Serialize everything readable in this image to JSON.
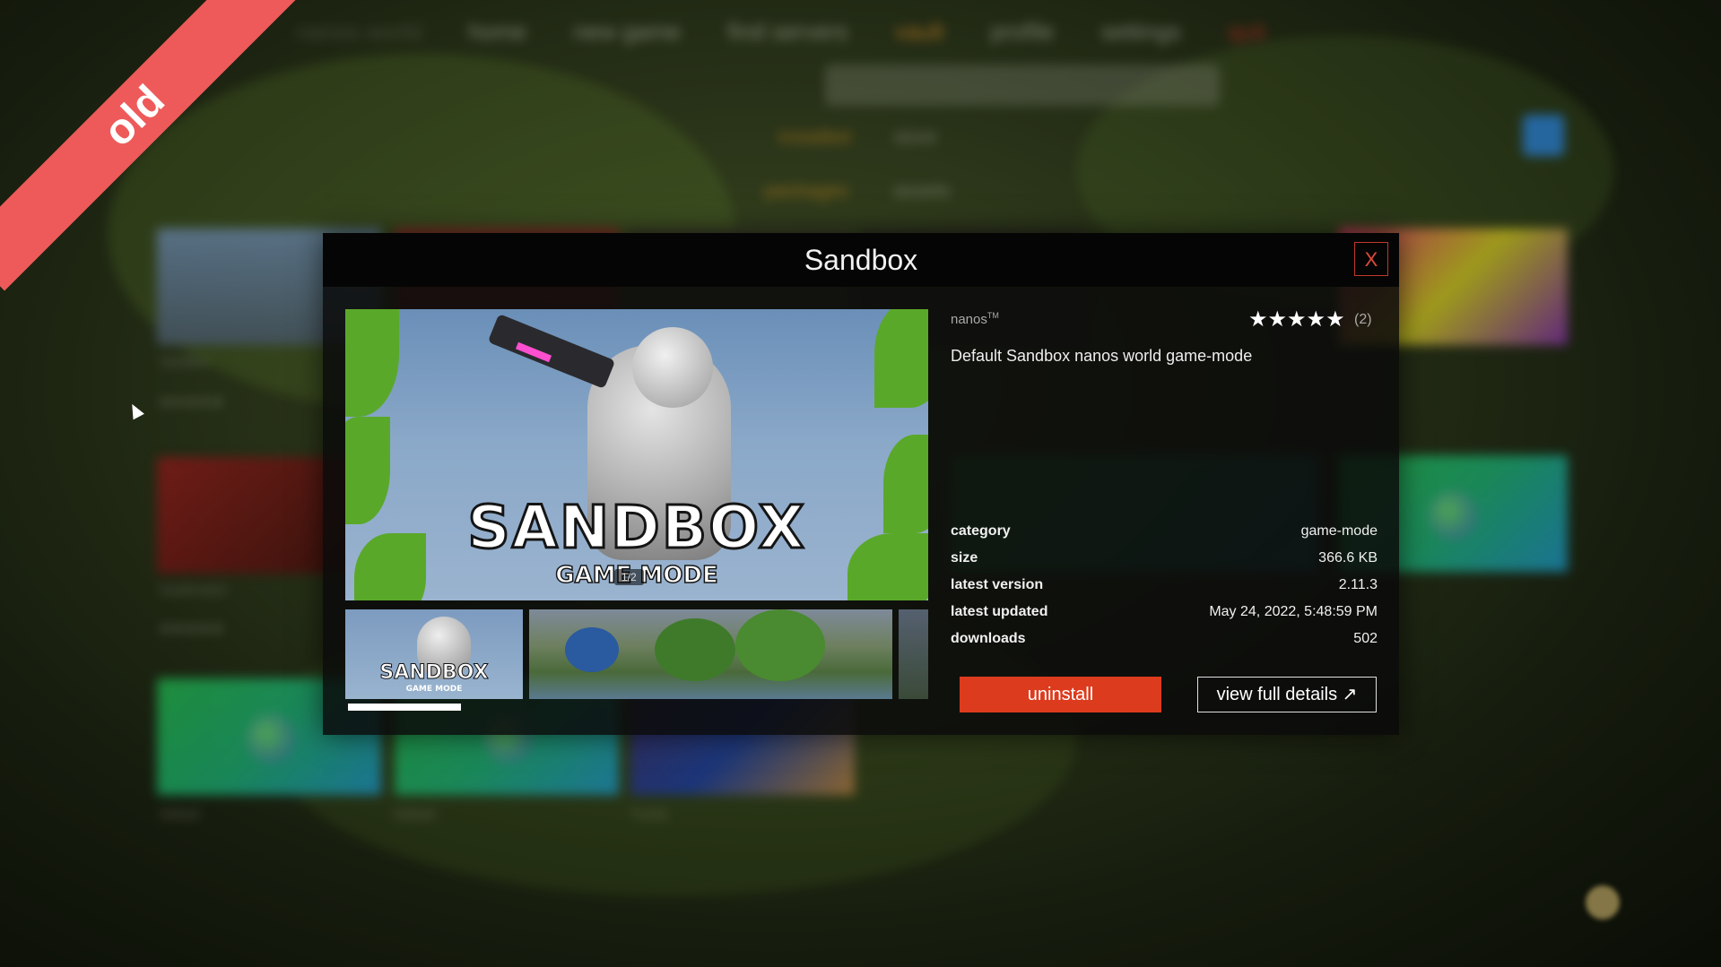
{
  "ribbon": {
    "label": "old"
  },
  "background": {
    "nav": [
      "home",
      "new game",
      "find servers",
      "vault",
      "profile",
      "settings"
    ],
    "active_nav": "vault",
    "accent_color": "#f0962a"
  },
  "modal": {
    "title": "Sandbox",
    "close_label": "X",
    "author": "nanos",
    "author_mark": "TM",
    "stars": "★★★★★",
    "rating_count": "(2)",
    "description": "Default Sandbox nanos world game-mode",
    "image": {
      "logo": "SANDBOX",
      "sublogo": "GAME MODE",
      "counter": "1/2",
      "thumb_logo": "SANDBOX",
      "thumb_sublogo": "GAME MODE"
    },
    "details": [
      {
        "label": "category",
        "value": "game-mode"
      },
      {
        "label": "size",
        "value": "366.6 KB"
      },
      {
        "label": "latest version",
        "value": "2.11.3"
      },
      {
        "label": "latest updated",
        "value": "May 24, 2022, 5:48:59 PM"
      },
      {
        "label": "downloads",
        "value": "502"
      }
    ],
    "uninstall_label": "uninstall",
    "view_details_label": "view full details ↗",
    "uninstall_color": "#dd3b1e"
  }
}
